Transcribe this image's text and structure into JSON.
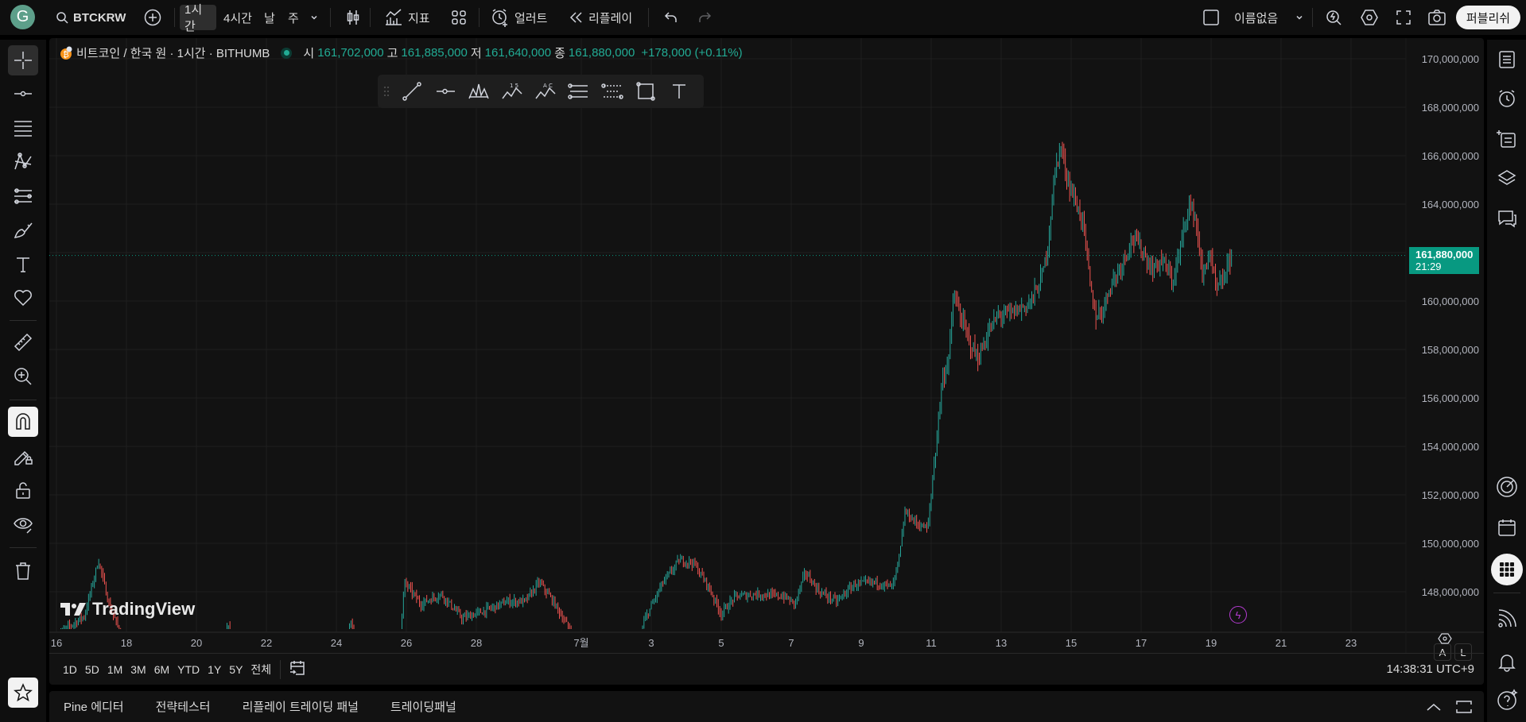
{
  "topbar": {
    "avatar_letter": "G",
    "symbol": "BTCKRW",
    "intervals": [
      "1시간",
      "4시간",
      "날",
      "주"
    ],
    "selected_interval": "1시간",
    "indicators_label": "지표",
    "alert_label": "얼러트",
    "replay_label": "리플레이",
    "layout_name": "이름없음",
    "publish_label": "퍼블리쉬"
  },
  "legend": {
    "title": "비트코인 / 한국 원 · 1시간 · BITHUMB",
    "open_label": "시",
    "open": "161,702,000",
    "high_label": "고",
    "high": "161,885,000",
    "low_label": "저",
    "low": "161,640,000",
    "close_label": "종",
    "close": "161,880,000",
    "change": "+178,000 (+0.11%)"
  },
  "price_badge": {
    "price": "161,880,000",
    "countdown": "21:29"
  },
  "range_buttons": [
    "1D",
    "5D",
    "1M",
    "3M",
    "6M",
    "YTD",
    "1Y",
    "5Y",
    "전체"
  ],
  "clock": "14:38:31 UTC+9",
  "scale_buttons": {
    "auto": "A",
    "log": "L"
  },
  "watermark": "TradingView",
  "bottom_tabs": [
    "Pine 에디터",
    "전략테스터",
    "리플레이 트레이딩 패널",
    "트레이딩패널"
  ],
  "colors": {
    "up": "#26a69a",
    "down": "#ef5350",
    "accent": "#089981",
    "background": "#121212"
  },
  "chart_data": {
    "type": "candlestick",
    "interval": "1h",
    "symbol": "BTCKRW",
    "title": "비트코인 / 한국 원 · 1시간 · BITHUMB",
    "ylim": [
      146500000,
      171000000
    ],
    "y_ticks": [
      "170,000,000",
      "168,000,000",
      "166,000,000",
      "164,000,000",
      "162,000,000",
      "160,000,000",
      "158,000,000",
      "156,000,000",
      "154,000,000",
      "152,000,000",
      "150,000,000",
      "148,000,000"
    ],
    "y_tick_values": [
      170,
      168,
      166,
      164,
      162,
      160,
      158,
      156,
      154,
      152,
      150,
      148
    ],
    "x_ticks": [
      {
        "day": 0,
        "label": "16"
      },
      {
        "day": 2,
        "label": "18"
      },
      {
        "day": 4,
        "label": "20"
      },
      {
        "day": 6,
        "label": "22"
      },
      {
        "day": 8,
        "label": "24"
      },
      {
        "day": 10,
        "label": "26"
      },
      {
        "day": 12,
        "label": "28"
      },
      {
        "day": 15,
        "label": "7월"
      },
      {
        "day": 17,
        "label": "3"
      },
      {
        "day": 19,
        "label": "5"
      },
      {
        "day": 21,
        "label": "7"
      },
      {
        "day": 23,
        "label": "9"
      },
      {
        "day": 25,
        "label": "11"
      },
      {
        "day": 27,
        "label": "13"
      },
      {
        "day": 29,
        "label": "15"
      },
      {
        "day": 31,
        "label": "17"
      },
      {
        "day": 33,
        "label": "19"
      },
      {
        "day": 35,
        "label": "21"
      },
      {
        "day": 37,
        "label": "23"
      }
    ],
    "x_unit": "days since Jun 16 00:00",
    "price_unit": "million KRW",
    "last_price": 161.88,
    "path_keypoints": [
      [
        0,
        146.2
      ],
      [
        0.8,
        147.0
      ],
      [
        1.2,
        149.3
      ],
      [
        1.5,
        147.5
      ],
      [
        1.9,
        146.0
      ],
      [
        4.5,
        145.0
      ],
      [
        4.9,
        146.6
      ],
      [
        5.1,
        145.3
      ],
      [
        8.2,
        145.5
      ],
      [
        8.4,
        146.8
      ],
      [
        8.6,
        145.5
      ],
      [
        9.8,
        145.6
      ],
      [
        9.95,
        148.4
      ],
      [
        10.4,
        147.5
      ],
      [
        11,
        147.9
      ],
      [
        11.6,
        146.9
      ],
      [
        12.2,
        147.2
      ],
      [
        12.9,
        147.6
      ],
      [
        13.4,
        147.6
      ],
      [
        13.8,
        148.4
      ],
      [
        14.2,
        147.6
      ],
      [
        14.6,
        146.6
      ],
      [
        15,
        145.6
      ],
      [
        16.6,
        145.6
      ],
      [
        16.8,
        146.8
      ],
      [
        17.3,
        148.3
      ],
      [
        17.8,
        149.3
      ],
      [
        18.2,
        149.2
      ],
      [
        18.6,
        148.3
      ],
      [
        19.0,
        147.1
      ],
      [
        19.4,
        147.8
      ],
      [
        20,
        147.9
      ],
      [
        20.8,
        147.8
      ],
      [
        21.1,
        147.5
      ],
      [
        21.4,
        148.8
      ],
      [
        21.8,
        148.0
      ],
      [
        22.3,
        147.6
      ],
      [
        22.8,
        148.3
      ],
      [
        23.4,
        148.4
      ],
      [
        23.9,
        148.2
      ],
      [
        24.1,
        149.5
      ],
      [
        24.25,
        151.3
      ],
      [
        24.6,
        150.8
      ],
      [
        24.9,
        150.6
      ],
      [
        25.1,
        153.5
      ],
      [
        25.3,
        156.6
      ],
      [
        25.5,
        157.7
      ],
      [
        25.65,
        160.3
      ],
      [
        25.8,
        159.5
      ],
      [
        26.1,
        158.3
      ],
      [
        26.35,
        157.6
      ],
      [
        26.6,
        158.6
      ],
      [
        26.9,
        159.4
      ],
      [
        27.3,
        159.5
      ],
      [
        27.8,
        159.9
      ],
      [
        28.1,
        160.7
      ],
      [
        28.3,
        161.9
      ],
      [
        28.55,
        165.5
      ],
      [
        28.7,
        166.4
      ],
      [
        28.9,
        165.0
      ],
      [
        29.1,
        164.2
      ],
      [
        29.35,
        163.2
      ],
      [
        29.55,
        160.5
      ],
      [
        29.7,
        159.4
      ],
      [
        29.9,
        159.6
      ],
      [
        30.1,
        160.6
      ],
      [
        30.4,
        161.4
      ],
      [
        30.75,
        162.6
      ],
      [
        31.0,
        162.2
      ],
      [
        31.3,
        161.3
      ],
      [
        31.6,
        161.7
      ],
      [
        31.9,
        160.8
      ],
      [
        32.1,
        162.0
      ],
      [
        32.35,
        164.0
      ],
      [
        32.55,
        163.5
      ],
      [
        32.75,
        161.0
      ],
      [
        32.95,
        162.0
      ],
      [
        33.15,
        160.4
      ],
      [
        33.35,
        160.9
      ],
      [
        33.6,
        161.88
      ]
    ]
  }
}
